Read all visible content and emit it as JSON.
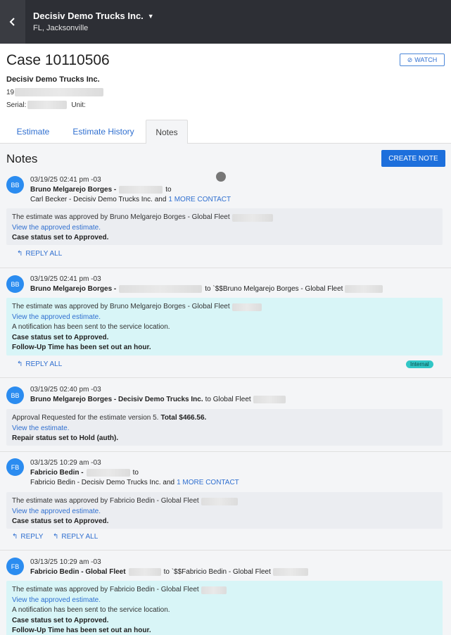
{
  "header": {
    "company": "Decisiv Demo Trucks Inc.",
    "location": "FL, Jacksonville",
    "back_icon": "chevron-left-icon",
    "dropdown_icon": "caret-down-icon"
  },
  "case": {
    "title": "Case 10110506",
    "watch_label": "WATCH",
    "company": "Decisiv Demo Trucks Inc.",
    "vin_prefix": "19",
    "serial_label": "Serial:",
    "unit_label": "Unit:"
  },
  "tabs": [
    {
      "label": "Estimate"
    },
    {
      "label": "Estimate History"
    },
    {
      "label": "Notes"
    }
  ],
  "notes_section": {
    "title": "Notes",
    "create_label": "CREATE NOTE"
  },
  "notes": [
    {
      "initials": "BB",
      "date": "03/19/25 02:41 pm -03",
      "author": "Bruno Melgarejo Borges -",
      "to": "to",
      "recipients": "Carl Becker - Decisiv Demo Trucks Inc. and",
      "more": "1 MORE CONTACT",
      "lines": [
        "The estimate was approved by Bruno Melgarejo Borges - Global Fleet",
        "View the approved estimate.",
        "Case status set to Approved."
      ],
      "reply_all": "REPLY ALL"
    },
    {
      "initials": "BB",
      "date": "03/19/25 02:41 pm -03",
      "author": "Bruno Melgarejo Borges -",
      "to": "to `$$Bruno Melgarejo Borges - Global Fleet",
      "lines": [
        "The estimate was approved by Bruno Melgarejo Borges - Global Fleet",
        "View the approved estimate.",
        "A notification has been sent to the service location.",
        "Case status set to Approved.",
        "Follow-Up Time has been set out an hour."
      ],
      "reply_all": "REPLY ALL",
      "badge": "Internal"
    },
    {
      "initials": "BB",
      "date": "03/19/25 02:40 pm -03",
      "author": "Bruno Melgarejo Borges - Decisiv Demo Trucks Inc.",
      "to": "to Global Fleet",
      "approval_text": "Approval Requested for the estimate version 5.",
      "approval_total": "Total $466.56.",
      "view_link": "View the estimate.",
      "status": "Repair status set to Hold (auth)."
    },
    {
      "initials": "FB",
      "date": "03/13/25 10:29 am -03",
      "author": "Fabricio Bedin -",
      "to": "to",
      "recipients": "Fabricio Bedin - Decisiv Demo Trucks Inc. and",
      "more": "1 MORE CONTACT",
      "lines": [
        "The estimate was approved by Fabricio Bedin - Global Fleet",
        "View the approved estimate.",
        "Case status set to Approved."
      ],
      "reply": "REPLY",
      "reply_all": "REPLY ALL"
    },
    {
      "initials": "FB",
      "date": "03/13/25 10:29 am -03",
      "author": "Fabricio Bedin - Global Fleet",
      "to": "to `$$Fabricio Bedin - Global Fleet",
      "lines": [
        "The estimate was approved by Fabricio Bedin - Global Fleet",
        "View the approved estimate.",
        "A notification has been sent to the service location.",
        "Case status set to Approved.",
        "Follow-Up Time has been set out an hour."
      ]
    }
  ],
  "colors": {
    "topbar": "#2d2f35",
    "accent": "#1d6fdc",
    "link": "#2f6fd0",
    "internal_bg": "#d8f5f7",
    "badge": "#31c6c6"
  }
}
